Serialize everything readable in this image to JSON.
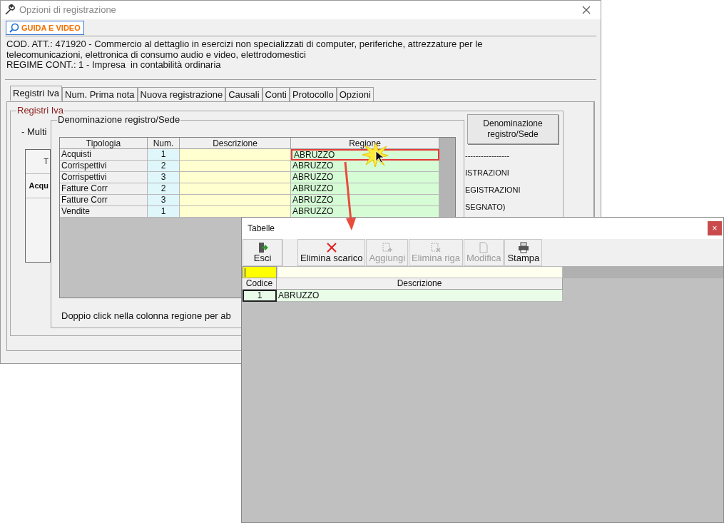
{
  "window": {
    "title": "Opzioni di registrazione",
    "guide_button": "GUIDA E VIDEO",
    "info": "COD. ATT.: 471920 - Commercio al dettaglio in esercizi non specializzati di computer, periferiche, attrezzature per le telecomunicazioni, elettronica di consumo audio e video, elettrodomestici",
    "regime": "REGIME CONT.: 1 - Impresa  in contabilità ordinaria",
    "tabs": [
      {
        "label": "Registri Iva",
        "selected": true
      },
      {
        "label": "Num. Prima nota",
        "selected": false
      },
      {
        "label": "Nuova registrazione",
        "selected": false
      },
      {
        "label": "Causali",
        "selected": false
      },
      {
        "label": "Conti",
        "selected": false
      },
      {
        "label": "Protocollo",
        "selected": false
      },
      {
        "label": "Opzioni",
        "selected": false
      }
    ],
    "group_title": "Registri Iva",
    "multi_label": "- Multi",
    "background_cells": [
      {
        "text": "T",
        "bold": false
      },
      {
        "text": "Acqu",
        "bold": true
      }
    ],
    "side_button": "Denominazione registro/Sede",
    "side_texts": [
      "-----------------",
      "ISTRAZIONI",
      "EGISTRAZIONI",
      "SEGNATO)"
    ],
    "panel": {
      "title": "Denominazione registro/Sede",
      "columns": [
        "Tipologia",
        "Num.",
        "Descrizione",
        "Regione"
      ],
      "rows": [
        {
          "tipologia": "Acquisti",
          "num": "1",
          "descrizione": "",
          "regione": "ABRUZZO",
          "selected": true
        },
        {
          "tipologia": "Corrispettivi",
          "num": "2",
          "descrizione": "",
          "regione": "ABRUZZO",
          "selected": false
        },
        {
          "tipologia": "Corrispettivi",
          "num": "3",
          "descrizione": "",
          "regione": "ABRUZZO",
          "selected": false
        },
        {
          "tipologia": "Fatture Corr",
          "num": "2",
          "descrizione": "",
          "regione": "ABRUZZO",
          "selected": false
        },
        {
          "tipologia": "Fatture Corr",
          "num": "3",
          "descrizione": "",
          "regione": "ABRUZZO",
          "selected": false
        },
        {
          "tipologia": "Vendite",
          "num": "1",
          "descrizione": "",
          "regione": "ABRUZZO",
          "selected": false
        }
      ],
      "hint": "Doppio click nella colonna regione per ab"
    }
  },
  "dialog": {
    "title": "Tabelle",
    "close": "×",
    "toolbar": [
      {
        "kind": "exit",
        "label": "Esci",
        "disabled": false
      },
      {
        "kind": "delete",
        "label": "Elimina scarico",
        "disabled": false
      },
      {
        "kind": "add",
        "label": "Aggiungi",
        "disabled": true
      },
      {
        "kind": "remove",
        "label": "Elimina riga",
        "disabled": true
      },
      {
        "kind": "edit",
        "label": "Modifica",
        "disabled": true
      },
      {
        "kind": "print",
        "label": "Stampa",
        "disabled": false
      }
    ],
    "columns": [
      "Codice",
      "Descrizione"
    ],
    "rows": [
      {
        "codice": "1",
        "descrizione": "ABRUZZO"
      }
    ]
  }
}
